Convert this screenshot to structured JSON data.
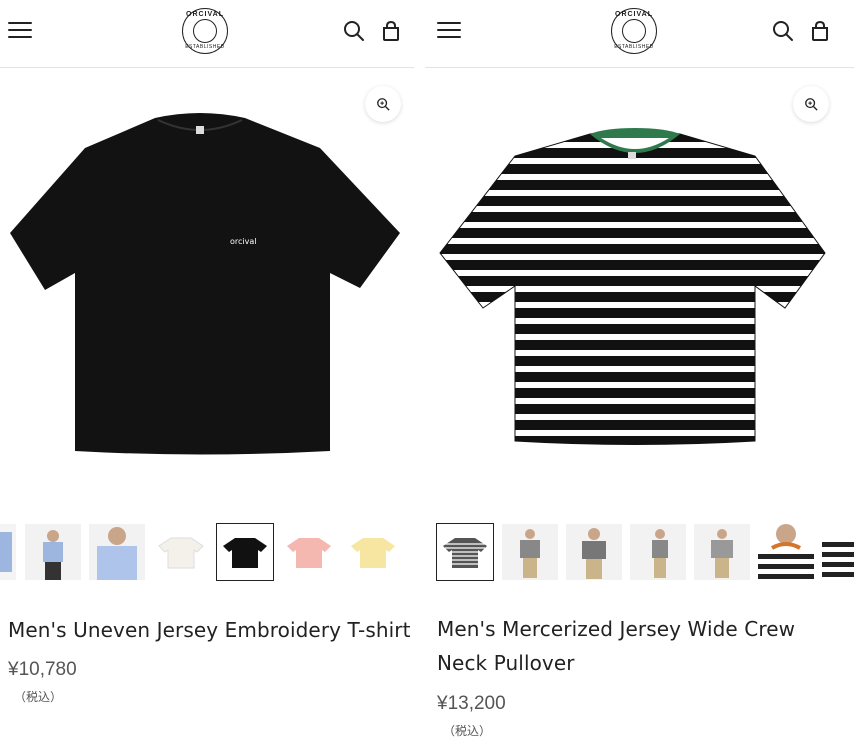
{
  "products": [
    {
      "title": "Men's Uneven Jersey Embroidery T-shirt",
      "price": "¥10,780",
      "tax": "（税込）",
      "print_text": "orcival"
    },
    {
      "title_line1": "Men's Mercerized Jersey Wide Crew",
      "title_line2": "Neck Pullover",
      "price": "¥13,200",
      "tax": "（税込）"
    }
  ],
  "logo": {
    "top": "ORCIVAL",
    "bottom": "ESTABLISHED"
  },
  "colors": {
    "black_tee": "#121212",
    "stripe_collar": "#2f7a4d",
    "accent_orange": "#d4752a"
  },
  "icons": [
    "menu-icon",
    "search-icon",
    "bag-icon",
    "zoom-in-icon"
  ]
}
